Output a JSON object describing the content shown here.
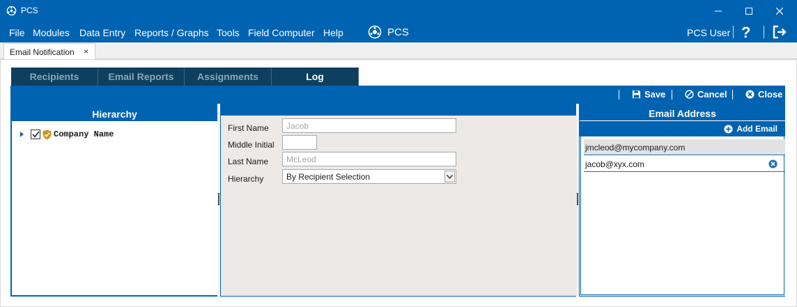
{
  "window": {
    "title": "PCS"
  },
  "menu": {
    "items": [
      "File",
      "Modules",
      "Data Entry",
      "Reports / Graphs",
      "Tools",
      "Field Computer",
      "Help"
    ],
    "brand": "PCS",
    "user": "PCS User",
    "help_icon": "?"
  },
  "doc_tab": {
    "label": "Email Notification",
    "close": "×"
  },
  "subtabs": [
    {
      "label": "Recipients",
      "active": false
    },
    {
      "label": "Email Reports",
      "active": false
    },
    {
      "label": "Assignments",
      "active": false
    },
    {
      "label": "Log",
      "active": true
    }
  ],
  "toolbar": {
    "save": "Save",
    "cancel": "Cancel",
    "close": "Close"
  },
  "hierarchy": {
    "header": "Hierarchy",
    "tree": [
      {
        "label": "Company Name",
        "checked": true,
        "expanded": false
      }
    ]
  },
  "form": {
    "first_name": {
      "label": "First Name",
      "value": "Jacob"
    },
    "middle_initial": {
      "label": "Middle Initial",
      "value": ""
    },
    "last_name": {
      "label": "Last Name",
      "value": "McLeod"
    },
    "hierarchy": {
      "label": "Hierarchy",
      "selected": "By Recipient Selection"
    }
  },
  "email": {
    "header": "Email Address",
    "add_label": "Add Email",
    "addresses": [
      "jmcleod@mycompany.com",
      "jacob@xyx.com"
    ]
  },
  "colors": {
    "brand_blue": "#0063b1",
    "tab_dark": "#0e3f5f",
    "form_bg": "#ece9e6",
    "shield": "#c9971c"
  },
  "icons": {
    "app": "pcs-logo-icon",
    "minimize": "minimize-icon",
    "maximize": "maximize-icon",
    "close": "close-icon",
    "logout": "logout-icon",
    "save": "floppy-disk-icon",
    "cancel": "cancel-circle-icon",
    "close_doc": "close-circle-icon",
    "add": "plus-circle-icon",
    "remove": "x-circle-icon"
  }
}
